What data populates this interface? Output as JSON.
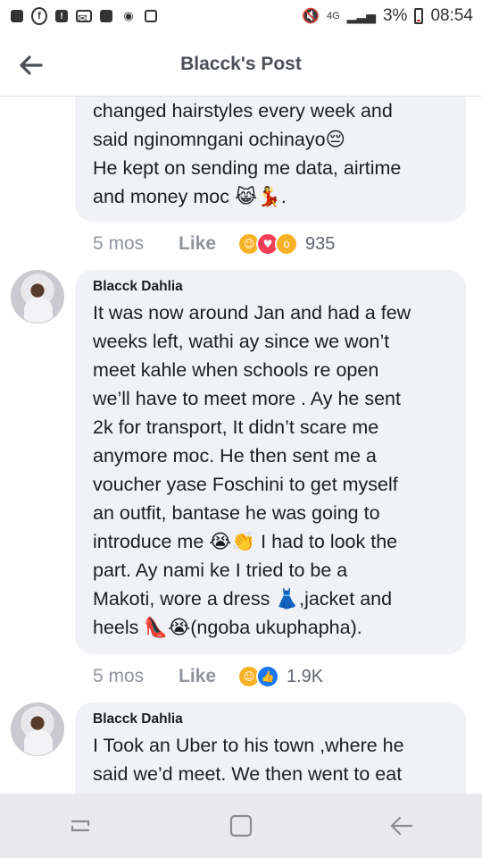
{
  "status_bar": {
    "network": "4G",
    "battery": "3%",
    "time": "08:54"
  },
  "header": {
    "title": "Blacck's Post"
  },
  "comments": [
    {
      "text_lines": [
        "changed hairstyles every week and",
        "said nginomngani ochinayo😔",
        "He kept on sending me data, airtime",
        "and money moc 😹💃."
      ],
      "time": "5 mos",
      "like_label": "Like",
      "reactions": [
        "haha",
        "love",
        "wow"
      ],
      "reaction_count": "935"
    },
    {
      "author": "Blacck Dahlia",
      "text_lines": [
        "It was now around Jan and had a few",
        "weeks left, wathi ay since we won’t",
        "meet kahle when schools re open",
        "we’ll have to meet more . Ay he sent",
        "2k for transport, It didn’t scare me",
        "anymore moc. He then sent me a",
        "voucher yase Foschini to get myself",
        "an outfit, bantase he was going to",
        "introduce me 😭👏 I had to look the",
        "part. Ay nami ke I tried to be a",
        "Makoti, wore a dress 👗,jacket and",
        "heels 👠😭(ngoba ukuphapha)."
      ],
      "time": "5 mos",
      "like_label": "Like",
      "reactions": [
        "haha",
        "like"
      ],
      "reaction_count": "1.9K"
    },
    {
      "author": "Blacck Dahlia",
      "text_lines": [
        "I Took an Uber to his town ,where he",
        "said we’d meet. We then went to eat"
      ]
    }
  ]
}
